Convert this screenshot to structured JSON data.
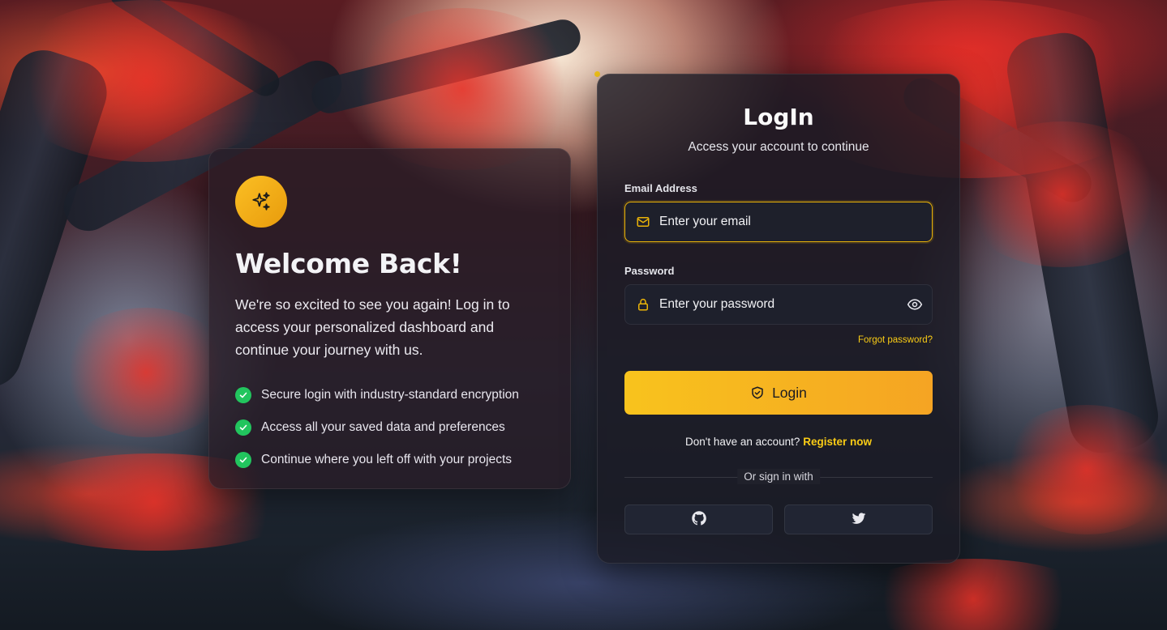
{
  "welcome": {
    "badge_icon": "sparkles-icon",
    "title": "Welcome Back!",
    "description": "We're so excited to see you again! Log in to access your personalized dashboard and continue your journey with us.",
    "features": [
      "Secure login with industry-standard encryption",
      "Access all your saved data and preferences",
      "Continue where you left off with your projects"
    ]
  },
  "login": {
    "title": "LogIn",
    "subtitle": "Access your account to continue",
    "email": {
      "label": "Email Address",
      "placeholder": "Enter your email",
      "icon": "mail-icon"
    },
    "password": {
      "label": "Password",
      "placeholder": "Enter your password",
      "icon": "lock-icon",
      "toggle_icon": "eye-icon"
    },
    "forgot_label": "Forgot password?",
    "submit_label": "Login",
    "submit_icon": "shield-check-icon",
    "register_prompt": "Don't have an account?",
    "register_link": "Register now",
    "divider_label": "Or sign in with",
    "social": [
      "github-icon",
      "twitter-icon"
    ]
  },
  "colors": {
    "accent": "#facc15",
    "button_gradient_start": "#f8c31d",
    "button_gradient_end": "#f5a423",
    "check_green": "#22c55e"
  }
}
